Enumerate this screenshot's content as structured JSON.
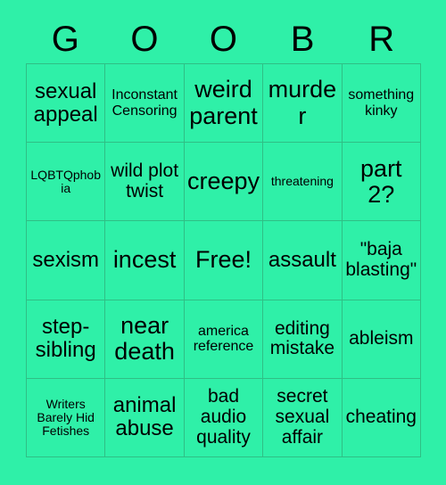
{
  "card": {
    "header_letters": [
      "G",
      "O",
      "O",
      "B",
      "R"
    ],
    "colors": {
      "background": "#2ff0a8",
      "cell_fill": "#2ff0a8",
      "grid_line": "#2fbf85",
      "text": "#000000"
    },
    "grid": {
      "columns": 5,
      "rows": 5,
      "cells": [
        {
          "text": "sexual appeal",
          "size": "lg"
        },
        {
          "text": "Inconstant Censoring",
          "size": "sm"
        },
        {
          "text": "weird parent",
          "size": "xl"
        },
        {
          "text": "murder",
          "size": "xl"
        },
        {
          "text": "something kinky",
          "size": "sm"
        },
        {
          "text": "LQBTQphobia",
          "size": "xs"
        },
        {
          "text": "wild plot twist",
          "size": "md"
        },
        {
          "text": "creepy",
          "size": "xl"
        },
        {
          "text": "threatening",
          "size": "xs"
        },
        {
          "text": "part 2?",
          "size": "xl"
        },
        {
          "text": "sexism",
          "size": "lg"
        },
        {
          "text": "incest",
          "size": "xl"
        },
        {
          "text": "Free!",
          "size": "xl"
        },
        {
          "text": "assault",
          "size": "lg"
        },
        {
          "text": "\"baja blasting\"",
          "size": "md"
        },
        {
          "text": "step-sibling",
          "size": "lg"
        },
        {
          "text": "near death",
          "size": "xl"
        },
        {
          "text": "america reference",
          "size": "sm"
        },
        {
          "text": "editing mistake",
          "size": "md"
        },
        {
          "text": "ableism",
          "size": "md"
        },
        {
          "text": "Writers Barely Hid Fetishes",
          "size": "xs"
        },
        {
          "text": "animal abuse",
          "size": "lg"
        },
        {
          "text": "bad audio quality",
          "size": "md"
        },
        {
          "text": "secret sexual affair",
          "size": "md"
        },
        {
          "text": "cheating",
          "size": "md"
        }
      ]
    }
  }
}
